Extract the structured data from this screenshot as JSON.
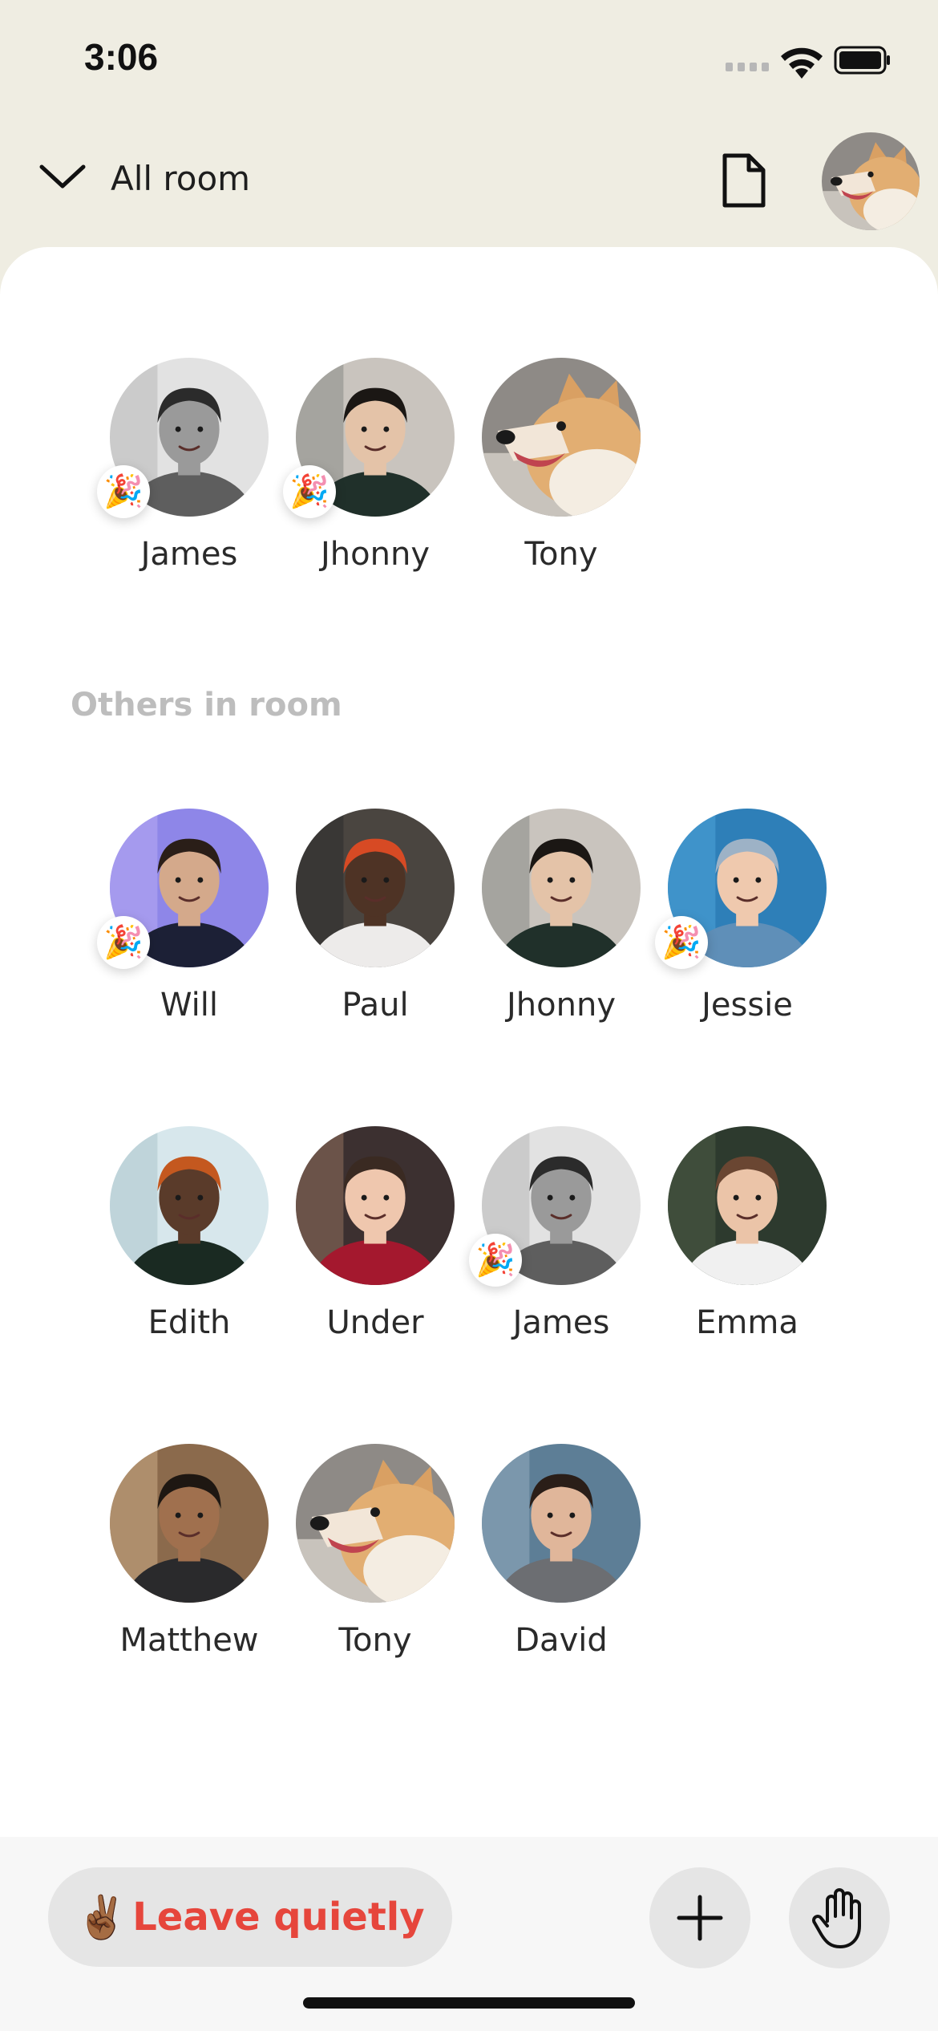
{
  "status_bar": {
    "time": "3:06"
  },
  "header": {
    "title": "All room",
    "avatar_subject": "dog"
  },
  "speakers": [
    {
      "name": "James",
      "subject": "man-smiling-grey",
      "celebrate": true
    },
    {
      "name": "Jhonny",
      "subject": "woman-hallway",
      "celebrate": true
    },
    {
      "name": "Tony",
      "subject": "dog",
      "celebrate": false
    }
  ],
  "others_label": "Others in room",
  "others": [
    {
      "name": "Will",
      "subject": "woman-purple",
      "celebrate": true
    },
    {
      "name": "Paul",
      "subject": "man-red-beanie",
      "celebrate": false
    },
    {
      "name": "Jhonny",
      "subject": "woman-hallway",
      "celebrate": false
    },
    {
      "name": "Jessie",
      "subject": "man-blue-hoodie",
      "celebrate": true
    },
    {
      "name": "Edith",
      "subject": "man-orange-beanie",
      "celebrate": false
    },
    {
      "name": "Under",
      "subject": "woman-red-sweater",
      "celebrate": false
    },
    {
      "name": "James",
      "subject": "man-smiling-grey",
      "celebrate": true
    },
    {
      "name": "Emma",
      "subject": "woman-striped",
      "celebrate": false
    },
    {
      "name": "Matthew",
      "subject": "man-outdoor",
      "celebrate": false
    },
    {
      "name": "Tony",
      "subject": "dog",
      "celebrate": false
    },
    {
      "name": "David",
      "subject": "man-grey-sweater",
      "celebrate": false
    }
  ],
  "celebrate_emoji": "🎉",
  "bottom_bar": {
    "leave_emoji": "✌🏾",
    "leave_label": "Leave quietly"
  },
  "colors": {
    "background": "#EFEDE2",
    "leave_text": "#E6463C",
    "section_label": "#BDBDBD"
  }
}
